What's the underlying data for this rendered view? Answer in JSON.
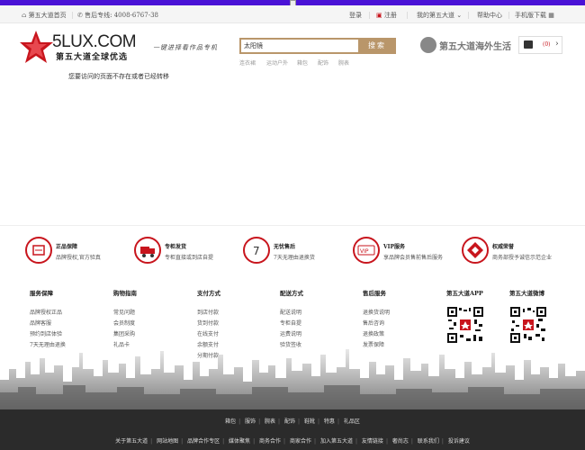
{
  "topbar": {
    "home_label": "第五大道首页",
    "hotline_label": "售后专线:",
    "hotline_number": "4008-6767-38",
    "login": "登录",
    "register": "注册",
    "my_account": "我的第五大道",
    "help": "帮助中心",
    "mobile": "手机版下载"
  },
  "header": {
    "logo_text": "5LUX.COM",
    "logo_sub": "第五大道全球优选",
    "slogan": "一键进择看作品专机",
    "brand2": "第五大道海外生活",
    "cart_count": "0"
  },
  "search": {
    "value": "太阳镜",
    "button": "搜索",
    "hot": [
      "连衣裙",
      "运动户外",
      "箱包",
      "配饰",
      "腕表"
    ]
  },
  "notice": "您要访问的页面不存在或者已经转移",
  "services": [
    {
      "title": "正品保障",
      "desc": "品牌授权,官方验真"
    },
    {
      "title": "专柜发货",
      "desc": "专柜直接或到店自提"
    },
    {
      "title": "无忧售后",
      "desc": "7天无理由退换货"
    },
    {
      "title": "VIP服务",
      "desc": "享品牌会员售前售后服务"
    },
    {
      "title": "权威荣誉",
      "desc": "商务部授予诚信示范企业"
    }
  ],
  "footer_cols": [
    {
      "heading": "服务保障",
      "links": [
        "品牌授权正品",
        "品牌客服",
        "预约到店体验",
        "7天无理由退换"
      ]
    },
    {
      "heading": "购物指南",
      "links": [
        "常见问题",
        "会员制度",
        "集团采购",
        "礼品卡"
      ]
    },
    {
      "heading": "支付方式",
      "links": [
        "到店付款",
        "货到付款",
        "在线支付",
        "余额支付",
        "分期付款"
      ]
    },
    {
      "heading": "配送方式",
      "links": [
        "配送说明",
        "专柜自提",
        "运费说明",
        "验货签收"
      ]
    },
    {
      "heading": "售后服务",
      "links": [
        "退换货说明",
        "售后咨询",
        "退换政策",
        "发票保障"
      ]
    }
  ],
  "app": {
    "label": "第五大道APP"
  },
  "weibo": {
    "label": "第五大道微博"
  },
  "bottom_links_1": [
    "箱包",
    "服饰",
    "腕表",
    "配饰",
    "鞋靴",
    "特惠",
    "礼品区"
  ],
  "bottom_links_2": [
    "关于第五大道",
    "网站地图",
    "品牌合作专区",
    "媒体聚焦",
    "商务合作",
    "商家合作",
    "加入第五大道",
    "友情链接",
    "奢尚志",
    "联系我们",
    "投诉建议"
  ],
  "colors": {
    "accent": "#b9966a",
    "brand_red": "#c8151d",
    "top_stripe": "#4a12d6"
  }
}
